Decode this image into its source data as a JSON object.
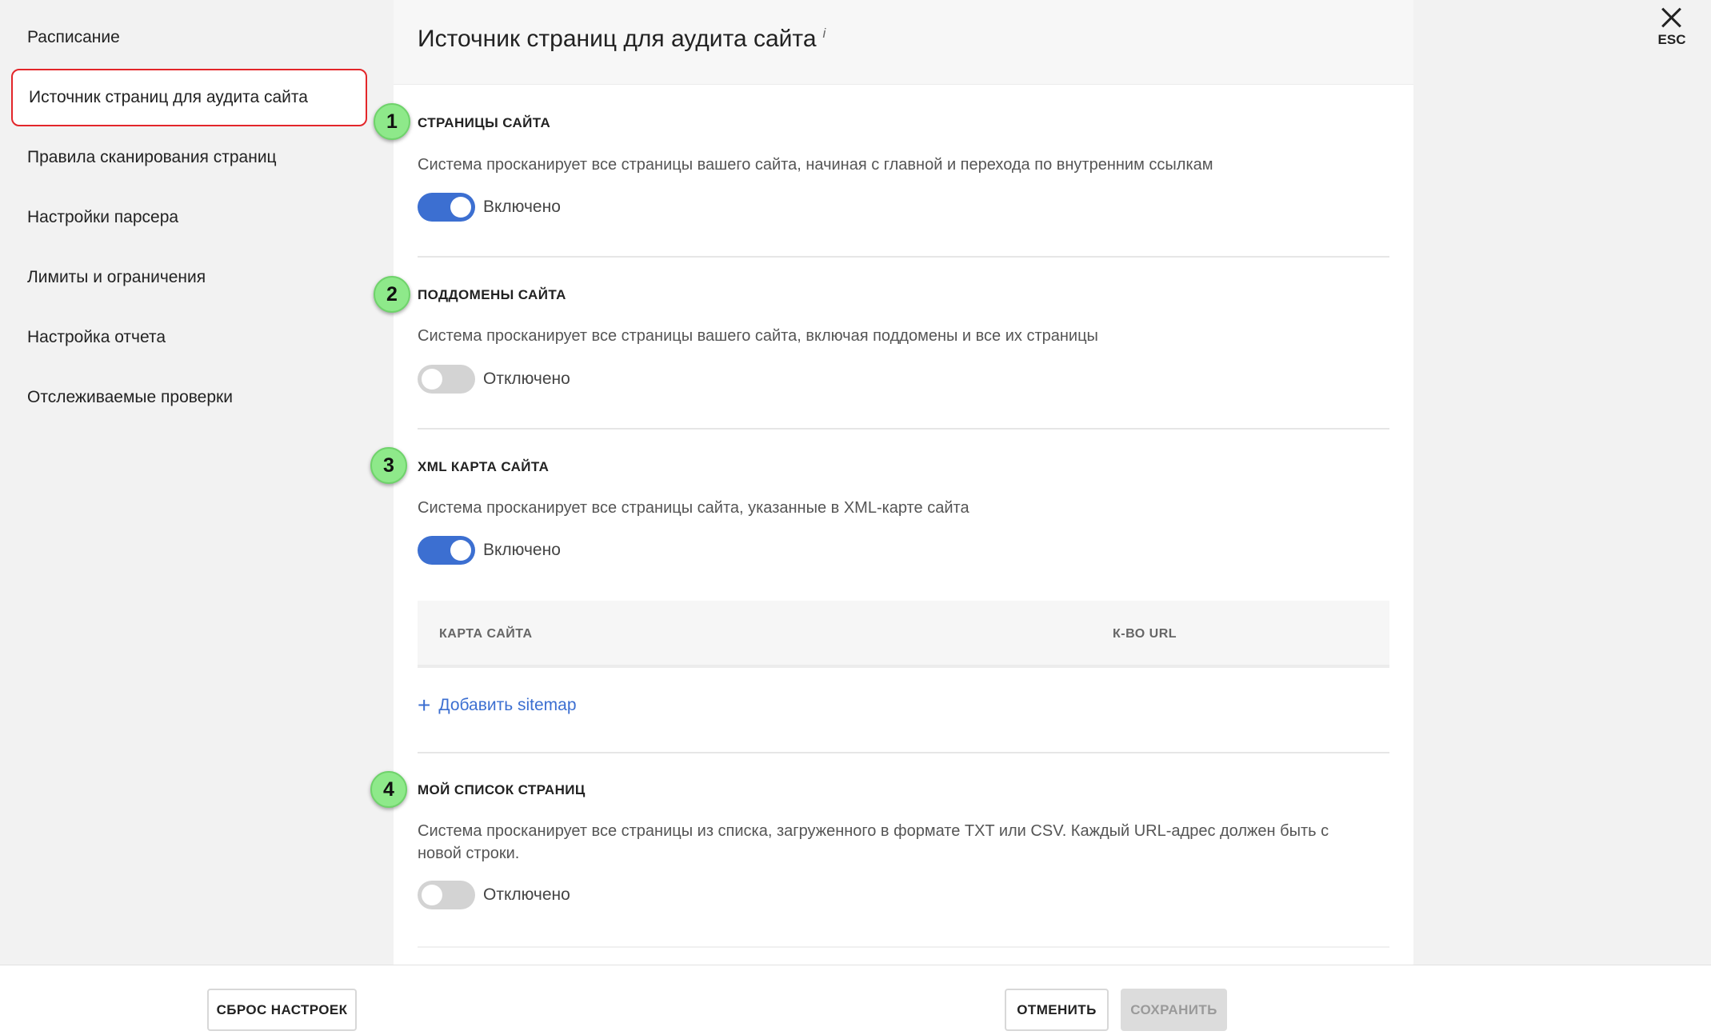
{
  "sidebar": {
    "items": [
      {
        "label": "Расписание"
      },
      {
        "label": "Источник страниц для аудита сайта",
        "active": true
      },
      {
        "label": "Правила сканирования страниц"
      },
      {
        "label": "Настройки парсера"
      },
      {
        "label": "Лимиты и ограничения"
      },
      {
        "label": "Настройка отчета"
      },
      {
        "label": "Отслеживаемые проверки"
      }
    ]
  },
  "panel": {
    "title": "Источник страниц для аудита сайта",
    "info_mark": "i",
    "sections": [
      {
        "badge": "1",
        "title": "СТРАНИЦЫ САЙТА",
        "description": "Система просканирует все страницы вашего сайта, начиная с главной и перехода по внутренним ссылкам",
        "toggle_state": "on",
        "toggle_label": "Включено"
      },
      {
        "badge": "2",
        "title": "ПОДДОМЕНЫ САЙТА",
        "description": "Система просканирует все страницы вашего сайта, включая поддомены и все их страницы",
        "toggle_state": "off",
        "toggle_label": "Отключено"
      },
      {
        "badge": "3",
        "title": "XML КАРТА САЙТА",
        "description": "Система просканирует все страницы сайта, указанные в XML-карте сайта",
        "toggle_state": "on",
        "toggle_label": "Включено",
        "table_headers": [
          "КАРТА САЙТА",
          "К-ВО URL"
        ],
        "add_link": "Добавить sitemap"
      },
      {
        "badge": "4",
        "title": "МОЙ СПИСОК СТРАНИЦ",
        "description_line1": "Система просканирует все страницы из списка, загруженного в формате TXT или CSV. Каждый URL-адрес должен быть с",
        "description_line2": "новой строки.",
        "toggle_state": "off",
        "toggle_label": "Отключено"
      }
    ]
  },
  "close": {
    "label": "ESC",
    "icon": "close-icon"
  },
  "footer": {
    "reset_label": "СБРОС НАСТРОЕК",
    "cancel_label": "ОТМЕНИТЬ",
    "save_label": "СОХРАНИТЬ"
  },
  "colors": {
    "accent": "#3c6fd1",
    "active_border": "#e3262a",
    "badge": "#8ee98a",
    "toggle_off": "#d3d3d3"
  }
}
